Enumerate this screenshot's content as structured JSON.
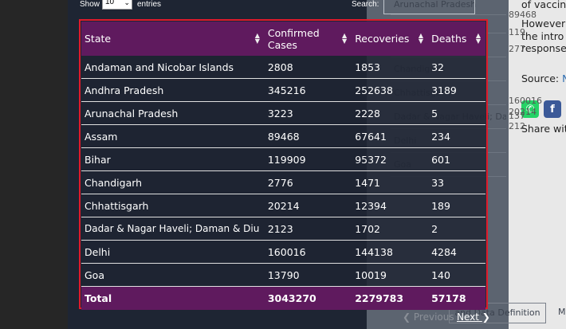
{
  "controls": {
    "show_label": "Show",
    "show_value": "10",
    "entries_label": "entries",
    "search_label": "Search:"
  },
  "table": {
    "headers": [
      "State",
      "Confirmed Cases",
      "Recoveries",
      "Deaths"
    ],
    "rows": [
      [
        "Andaman and Nicobar Islands",
        "2808",
        "1853",
        "32"
      ],
      [
        "Andhra Pradesh",
        "345216",
        "252638",
        "3189"
      ],
      [
        "Arunachal Pradesh",
        "3223",
        "2228",
        "5"
      ],
      [
        "Assam",
        "89468",
        "67641",
        "234"
      ],
      [
        "Bihar",
        "119909",
        "95372",
        "601"
      ],
      [
        "Chandigarh",
        "2776",
        "1471",
        "33"
      ],
      [
        "Chhattisgarh",
        "20214",
        "12394",
        "189"
      ],
      [
        "Dadar & Nagar Haveli; Daman & Diu",
        "2123",
        "1702",
        "2"
      ],
      [
        "Delhi",
        "160016",
        "144138",
        "4284"
      ],
      [
        "Goa",
        "13790",
        "10019",
        "140"
      ]
    ],
    "total": [
      "Total",
      "3043270",
      "2279783",
      "57178"
    ]
  },
  "pagination": {
    "previous": "Previous",
    "next": "Next"
  },
  "background": {
    "line1": "of vaccine",
    "line2": "However,",
    "line3": "the  intro",
    "line4": "response",
    "source_label": "Source:",
    "source_link": "Ne",
    "share_label": "Share with",
    "button": "and Data Definition",
    "m": "M",
    "ghost_list": [
      "Arunachal Pradesh",
      "Assam",
      "Bihar",
      "Chandigarh",
      "Chhattisgarh",
      "Dadar & Nagar Haveli; Dar",
      "Delhi",
      "Goa"
    ],
    "ghost_nums": [
      "89468",
      "119",
      "277",
      "20214",
      "212",
      "160016",
      "137"
    ]
  },
  "colors": {
    "header_bg": "#5f1a5e",
    "highlight_border": "#e01a2b",
    "panel_bg": "#1e2533"
  }
}
